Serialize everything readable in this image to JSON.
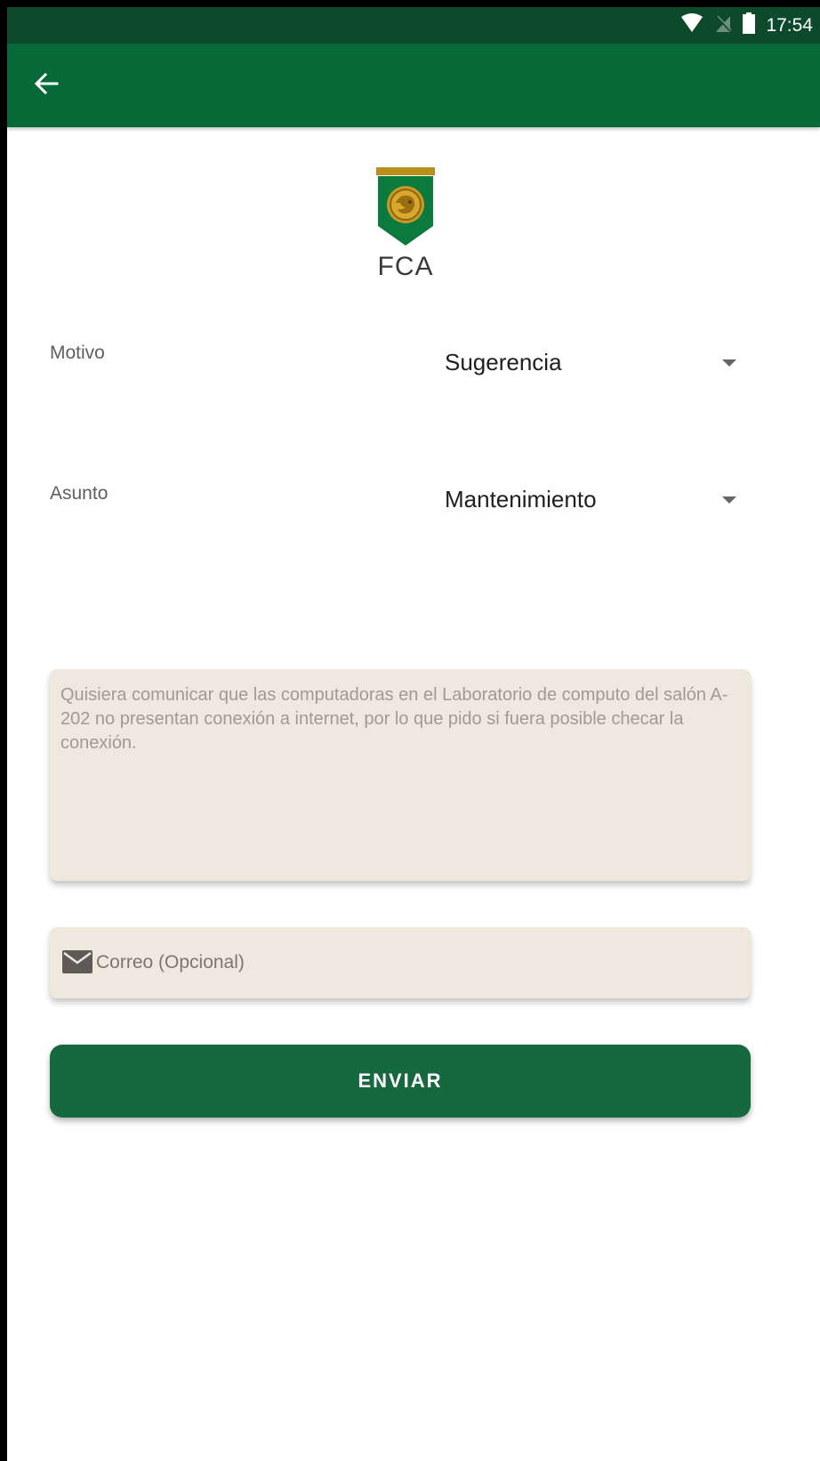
{
  "status_bar": {
    "time": "17:54",
    "icons": [
      "wifi-icon",
      "no-signal-icon",
      "battery-icon"
    ]
  },
  "app_bar": {
    "back_icon": "arrow-back-icon"
  },
  "logo": {
    "text": "FCA",
    "icon": "shield-emblem-icon"
  },
  "form": {
    "motivo": {
      "label": "Motivo",
      "selected": "Sugerencia"
    },
    "asunto": {
      "label": "Asunto",
      "selected": "Mantenimiento"
    },
    "message": {
      "placeholder": "Quisiera comunicar que las computadoras en el Laboratorio de computo del salón A-202 no presentan conexión a internet, por lo que pido si fuera posible checar la conexión."
    },
    "email": {
      "icon": "mail-icon",
      "placeholder": "Correo (Opcional)"
    },
    "submit_label": "ENVIAR"
  },
  "colors": {
    "status_bar": "#0d4a2c",
    "app_bar": "#056a37",
    "button": "#16683f",
    "input_background": "#efe8df",
    "logo_gold": "#b8901c"
  }
}
